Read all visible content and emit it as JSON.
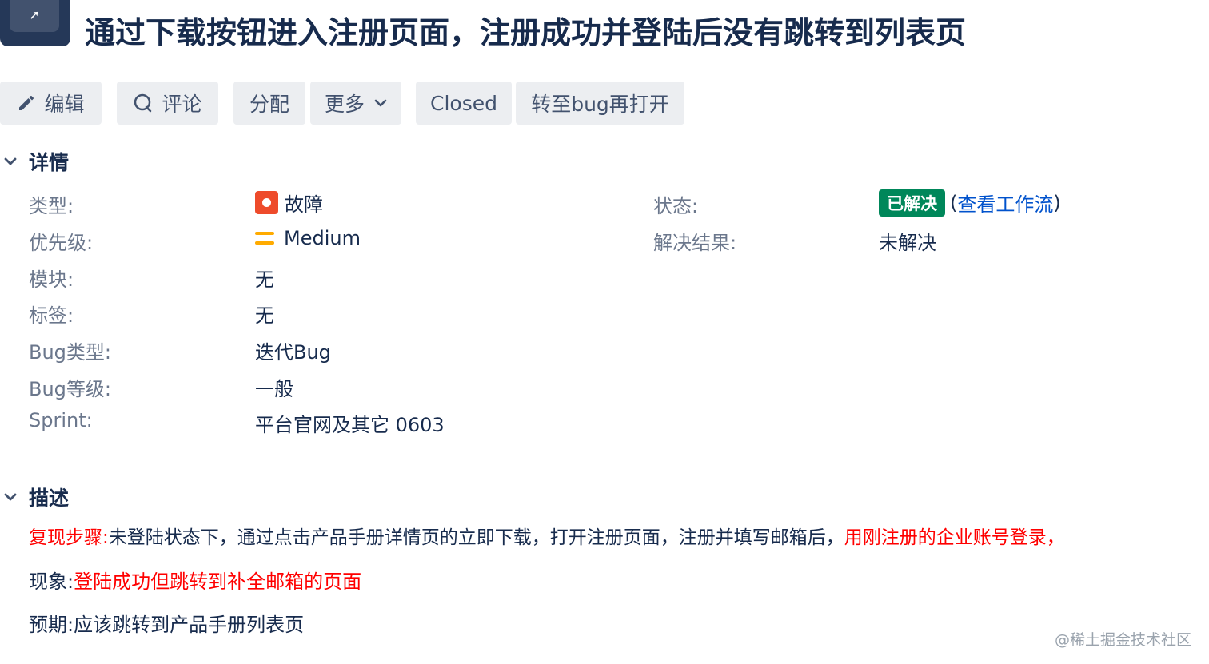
{
  "header": {
    "title": "通过下载按钮进入注册页面，注册成功并登陆后没有跳转到列表页",
    "issue_icon_glyph": "➚"
  },
  "toolbar": {
    "edit": "编辑",
    "comment": "评论",
    "assign": "分配",
    "more": "更多",
    "closed": "Closed",
    "reopen": "转至bug再打开"
  },
  "details": {
    "section_title": "详情",
    "type_label": "类型:",
    "type_value": "故障",
    "priority_label": "优先级:",
    "priority_value": "Medium",
    "module_label": "模块:",
    "module_value": "无",
    "tags_label": "标签:",
    "tags_value": "无",
    "bugtype_label": "Bug类型:",
    "bugtype_value": "迭代Bug",
    "buglevel_label": "Bug等级:",
    "buglevel_value": "一般",
    "sprint_label": "Sprint:",
    "sprint_value": "平台官网及其它 0603",
    "status_label": "状态:",
    "status_value": "已解决",
    "status_paren_open": "(",
    "status_link": "查看工作流",
    "status_paren_close": ")",
    "resolution_label": "解决结果:",
    "resolution_value": "未解决"
  },
  "description": {
    "section_title": "描述",
    "repro_label": "复现步骤:",
    "repro_text": "未登陆状态下，通过点击产品手册详情页的立即下载，打开注册页面，注册并填写邮箱后，",
    "repro_red": "用刚注册的企业账号登录，",
    "phenomenon_label": "现象:",
    "phenomenon_text": "登陆成功但跳转到补全邮箱的页面",
    "expected_label": "预期:",
    "expected_text": "应该跳转到产品手册列表页"
  },
  "colors": {
    "status_green": "#00875a",
    "bug_red": "#ee4b2b",
    "priority_orange": "#ffab00",
    "link_blue": "#0052cc",
    "highlight_red": "#ff0000"
  },
  "icons": [
    "issue-type-icon",
    "pencil-icon",
    "comment-icon",
    "chevron-down-icon",
    "bug-icon",
    "priority-medium-icon"
  ],
  "watermark": "@稀土掘金技术社区"
}
